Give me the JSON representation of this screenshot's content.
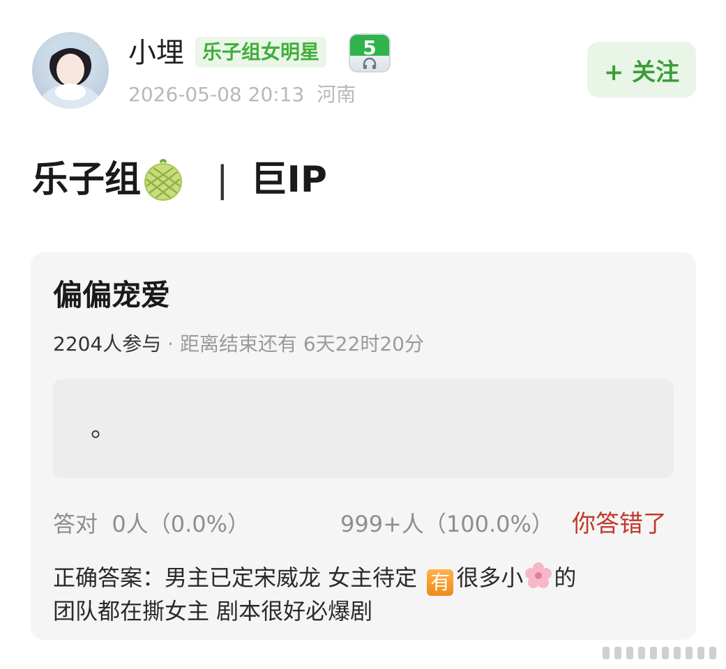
{
  "header": {
    "username": "小埋",
    "tag": "乐子组女明星",
    "level": "5",
    "timestamp": "2026-05-08 20:13",
    "location": "河南",
    "follow_label": "+ 关注"
  },
  "post": {
    "title_left": "乐子组",
    "title_sep": "|",
    "title_right": "巨IP"
  },
  "quiz": {
    "title": "偏偏宠爱",
    "participants": "2204人参与",
    "meta_sep": " · ",
    "countdown": "距离结束还有 6天22时20分",
    "option_text": "。",
    "correct_label": "答对",
    "correct_stat": "0人（0.0%）",
    "wrong_stat": "999+人（100.0%）",
    "result_label": "你答错了",
    "answer_prefix": "正确答案：男主已定宋威龙 女主待定",
    "answer_emoji": "有",
    "answer_mid": "很多小",
    "answer_suffix": "的",
    "answer_line2": "团队都在撕女主 剧本很好必爆剧"
  },
  "colors": {
    "accent_green": "#3b9d3a",
    "wrong_red": "#c0392b",
    "card_bg": "#f5f5f5"
  }
}
